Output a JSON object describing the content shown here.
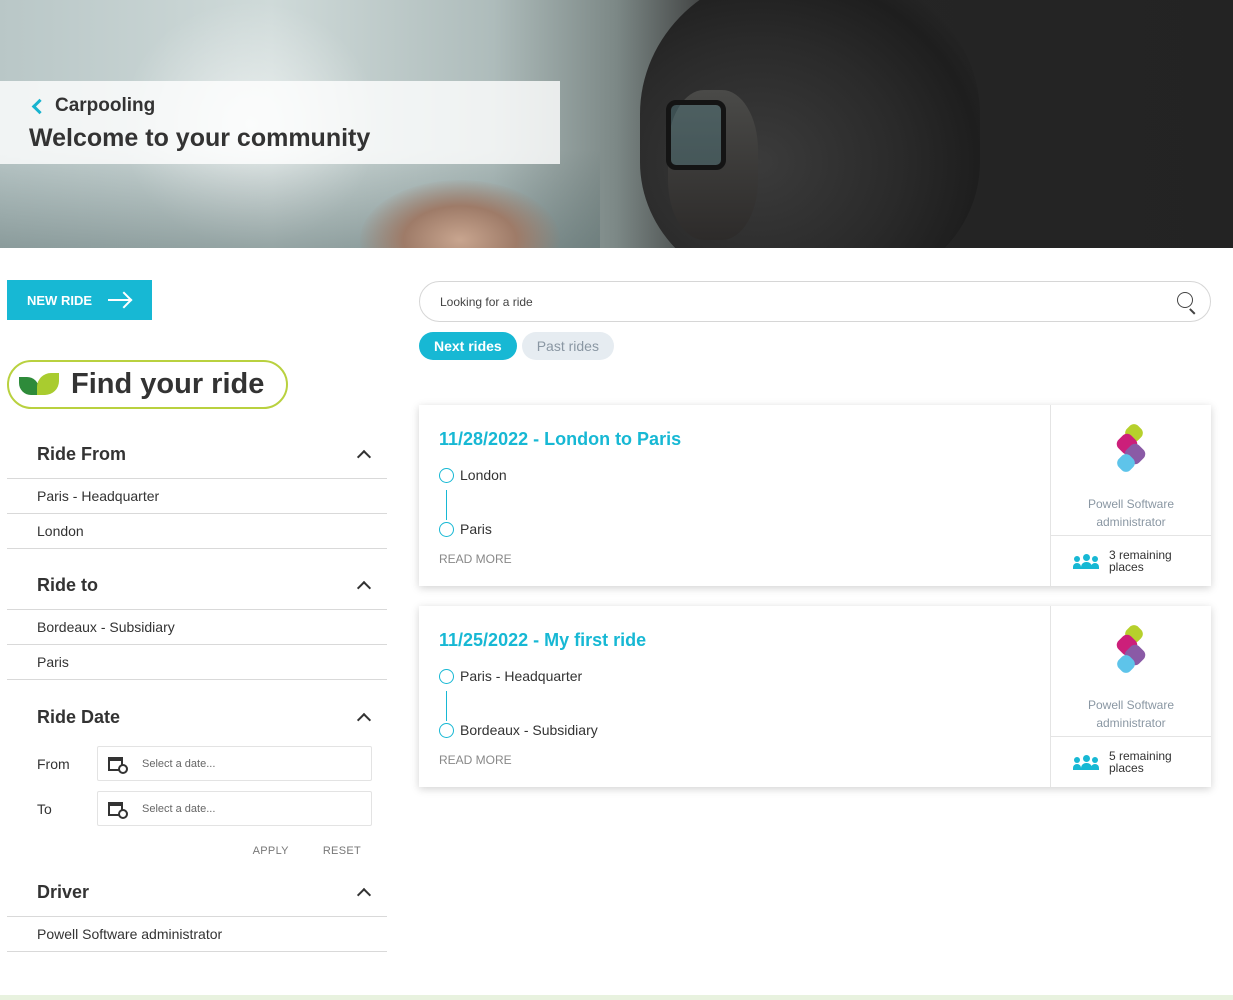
{
  "hero": {
    "back_label": "Carpooling",
    "title": "Welcome to your community"
  },
  "actions": {
    "new_ride_label": "NEW RIDE"
  },
  "filters": {
    "heading": "Find your ride",
    "ride_from": {
      "title": "Ride From",
      "items": [
        "Paris - Headquarter",
        "London"
      ]
    },
    "ride_to": {
      "title": "Ride to",
      "items": [
        "Bordeaux - Subsidiary",
        "Paris"
      ]
    },
    "ride_date": {
      "title": "Ride Date",
      "from_label": "From",
      "to_label": "To",
      "placeholder": "Select a date...",
      "apply_label": "APPLY",
      "reset_label": "RESET"
    },
    "driver": {
      "title": "Driver",
      "items": [
        "Powell Software administrator"
      ]
    }
  },
  "search": {
    "placeholder": "Looking for a ride"
  },
  "tabs": [
    {
      "label": "Next rides",
      "active": true
    },
    {
      "label": "Past rides",
      "active": false
    }
  ],
  "rides": [
    {
      "title": "11/28/2022 - London to Paris",
      "from": "London",
      "to": "Paris",
      "read_more": "READ MORE",
      "driver": "Powell Software administrator",
      "places": "3 remaining places"
    },
    {
      "title": "11/25/2022 - My first ride",
      "from": "Paris - Headquarter",
      "to": "Bordeaux - Subsidiary",
      "read_more": "READ MORE",
      "driver": "Powell Software administrator",
      "places": "5 remaining places"
    }
  ],
  "colors": {
    "accent": "#17b8d4",
    "badge_border": "#b9d13f",
    "leaf_dark": "#2e8b3a",
    "leaf_light": "#a9cc2f"
  }
}
